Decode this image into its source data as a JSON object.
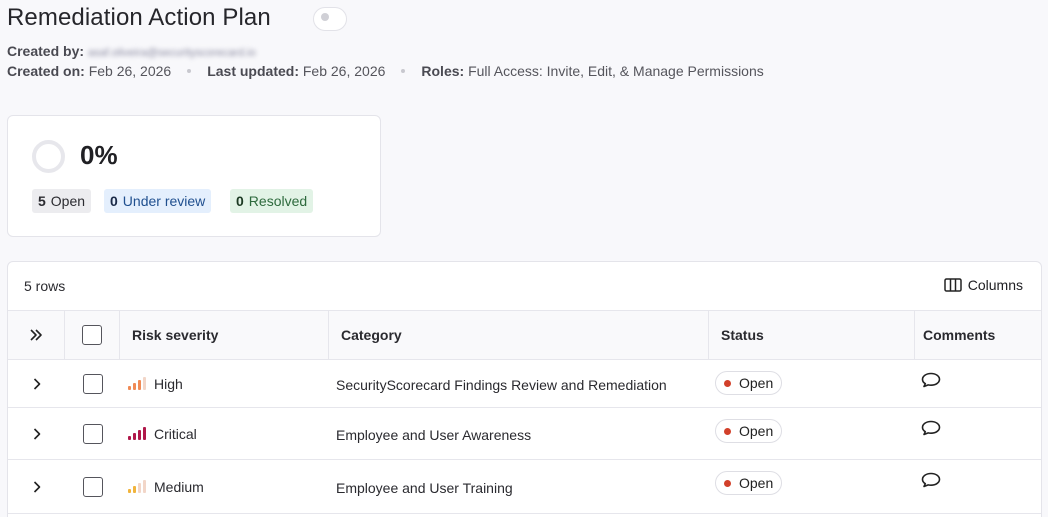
{
  "page": {
    "title": "Remediation Action Plan",
    "created_by_label": "Created by:",
    "created_by_value": "asaf.oliveira@securityscorecard.io",
    "created_on_label": "Created on:",
    "created_on_value": "Feb 26, 2026",
    "last_updated_label": "Last updated:",
    "last_updated_value": "Feb 26, 2026",
    "roles_label": "Roles:",
    "roles_value": "Full Access: Invite, Edit, & Manage Permissions"
  },
  "progress": {
    "percent_text": "0%",
    "percent_value": 0,
    "open_count": "5",
    "open_label": "Open",
    "review_count": "0",
    "review_label": "Under review",
    "resolved_count": "0",
    "resolved_label": "Resolved"
  },
  "table": {
    "row_count_text": "5 rows",
    "columns_button": "Columns",
    "headers": {
      "severity": "Risk severity",
      "category": "Category",
      "status": "Status",
      "comments": "Comments"
    },
    "rows": [
      {
        "severity": "High",
        "severity_level": 3,
        "severity_color": "#f08a55",
        "category": "SecurityScorecard Findings Review and Remediation",
        "status": "Open"
      },
      {
        "severity": "Critical",
        "severity_level": 4,
        "severity_color": "#b0184a",
        "category": "Employee and User Awareness",
        "status": "Open"
      },
      {
        "severity": "Medium",
        "severity_level": 2,
        "severity_color": "#f1b43c",
        "category": "Employee and User Training",
        "status": "Open"
      }
    ]
  },
  "icons": {
    "expand_all": "double-chevron-right-icon",
    "row_expand": "chevron-right-icon",
    "columns": "columns-icon",
    "comment": "speech-bubble-icon",
    "severity": "signal-bars-icon"
  },
  "colors": {
    "status_open": "#d2402a",
    "bar_inactive": "#f2d6c8"
  }
}
